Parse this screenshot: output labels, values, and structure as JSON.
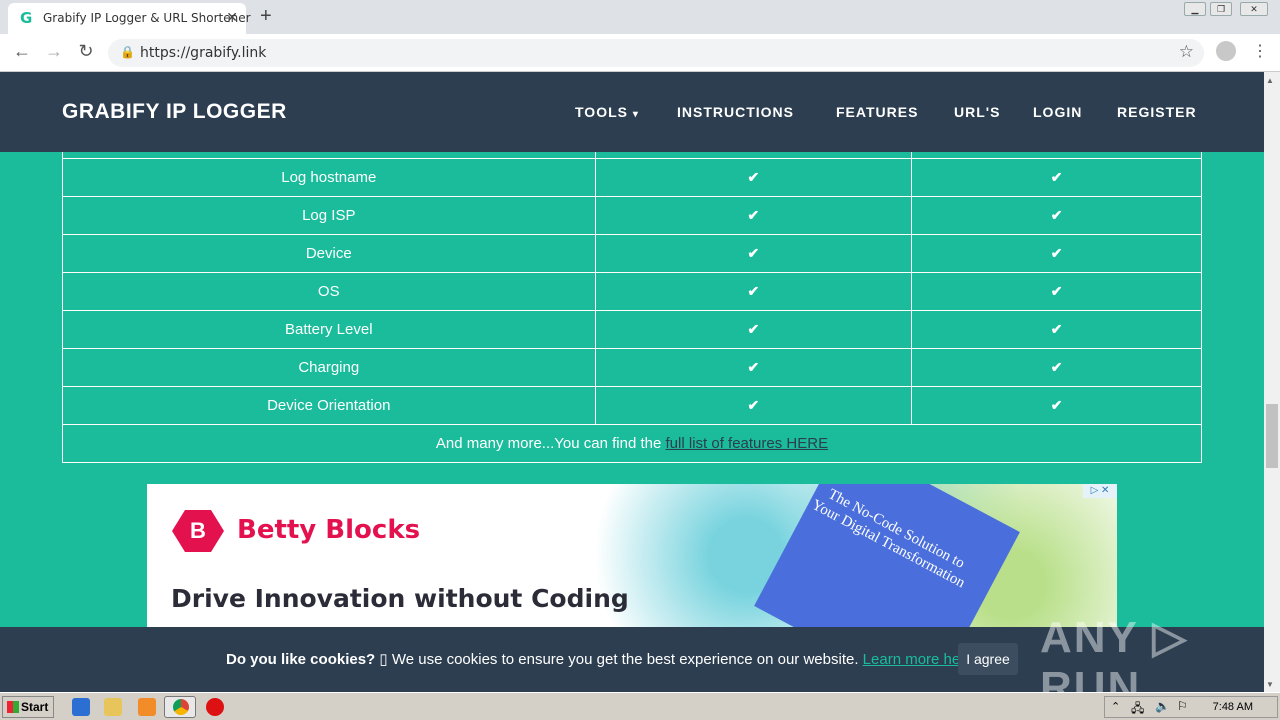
{
  "browser": {
    "tab_title": "Grabify IP Logger & URL Shortener",
    "favicon": "G",
    "url": "https://grabify.link"
  },
  "navbar": {
    "brand": "GRABIFY IP LOGGER",
    "items": [
      "TOOLS",
      "INSTRUCTIONS",
      "FEATURES",
      "URL'S",
      "LOGIN",
      "REGISTER"
    ]
  },
  "table": {
    "rows": [
      {
        "feature": "Log hostname",
        "free": "✔",
        "premium": "✔"
      },
      {
        "feature": "Log ISP",
        "free": "✔",
        "premium": "✔"
      },
      {
        "feature": "Device",
        "free": "✔",
        "premium": "✔"
      },
      {
        "feature": "OS",
        "free": "✔",
        "premium": "✔"
      },
      {
        "feature": "Battery Level",
        "free": "✔",
        "premium": "✔"
      },
      {
        "feature": "Charging",
        "free": "✔",
        "premium": "✔"
      },
      {
        "feature": "Device Orientation",
        "free": "✔",
        "premium": "✔"
      }
    ],
    "footer_text": "And many more...You can find the ",
    "footer_link": "full list of features HERE"
  },
  "ad": {
    "logo_letter": "B",
    "brand": "Betty Blocks",
    "headline": "Drive Innovation without Coding",
    "book_text": "The No-Code Solution to Your Digital Transformation",
    "choices": "▷ ✕"
  },
  "cookie": {
    "question": "Do you like cookies?",
    "emoji": "▯",
    "text": " We use cookies to ensure you get the best experience on our website. ",
    "link": "Learn more here",
    "button": "I agree"
  },
  "watermark": "ANY ▷ RUN",
  "taskbar": {
    "start": "Start",
    "clock": "7:48 AM"
  },
  "colors": {
    "teal": "#1abc9c",
    "navy": "#2c3e50",
    "ad_brand": "#e3124f"
  }
}
